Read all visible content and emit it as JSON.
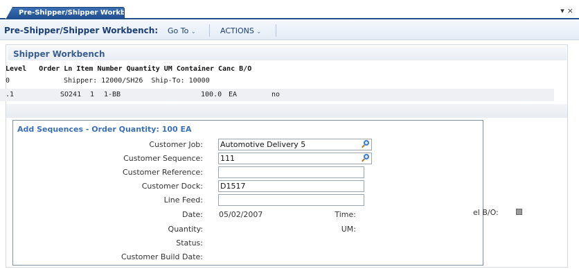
{
  "tab": {
    "label": "Pre-Shipper/Shipper Workb..."
  },
  "window_controls": {
    "dropdown": "▾",
    "close": "×"
  },
  "menubar": {
    "title": "Pre-Shipper/Shipper Workbench:",
    "goto_label": "Go To",
    "actions_label": "ACTIONS",
    "caret": "⌄"
  },
  "section": {
    "title": "Shipper Workbench"
  },
  "grid": {
    "header": "Level   Order Ln Item Number Quantity UM Container Canc B/O",
    "rows": [
      {
        "level": "0",
        "text": "Shipper: 12000/SH26  Ship-To: 10000"
      },
      {
        "level": ".1",
        "order": "SO241",
        "line": "1",
        "item": "1-BB",
        "quantity": "100.0",
        "um": "EA",
        "canc": "no"
      }
    ]
  },
  "dialog": {
    "title": "Add Sequences - Order Quantity: 100 EA",
    "fields": {
      "customer_job": {
        "label": "Customer Job:",
        "value": "Automotive Delivery 5"
      },
      "customer_sequence": {
        "label": "Customer Sequence:",
        "value": "111"
      },
      "customer_reference": {
        "label": "Customer Reference:",
        "value": ""
      },
      "customer_dock": {
        "label": "Customer Dock:",
        "value": "D1517"
      },
      "line_feed": {
        "label": "Line Feed:",
        "value": ""
      }
    },
    "date": {
      "label": "Date:",
      "value": "05/02/2007"
    },
    "time": {
      "label": "Time:",
      "value": ""
    },
    "quantity": {
      "label": "Quantity:",
      "value": ""
    },
    "um": {
      "label": "UM:",
      "value": ""
    },
    "status": {
      "label": "Status:",
      "value": ""
    },
    "customer_build_date": {
      "label": "Customer Build Date:",
      "value": ""
    }
  },
  "cancel_bo": {
    "label": "el B/O:",
    "checked": false
  },
  "colors": {
    "tab": "#1e4d8c",
    "title_blue": "#1b3f74",
    "section_text": "#3a5f8f",
    "dialog_title": "#3a70b8"
  },
  "icons": {
    "lookup": "magnifier-icon",
    "dropdown": "chevron-down-icon",
    "close": "close-icon"
  }
}
